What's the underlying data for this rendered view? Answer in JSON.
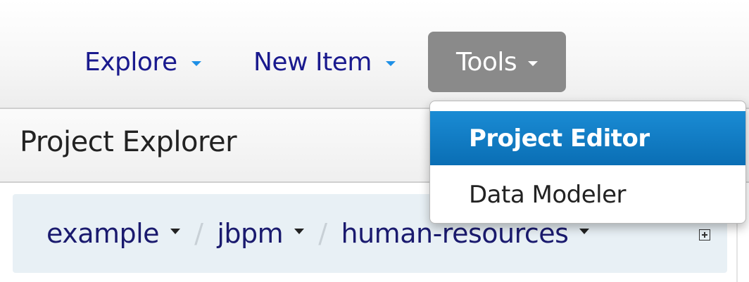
{
  "nav": {
    "explore_label": "Explore",
    "new_item_label": "New Item",
    "tools_label": "Tools"
  },
  "panel": {
    "title": "Project Explorer"
  },
  "breadcrumb": {
    "items": [
      {
        "label": "example"
      },
      {
        "label": "jbpm"
      },
      {
        "label": "human-resources"
      }
    ],
    "separator": "/"
  },
  "tools_menu": {
    "items": [
      {
        "label": "Project Editor",
        "active": true
      },
      {
        "label": "Data Modeler",
        "active": false
      }
    ]
  },
  "colors": {
    "link": "#1a1a8e",
    "caret_accent": "#1e90e6",
    "active_menu": "#0a6eb4",
    "tools_button_bg": "#8a8a8a"
  }
}
